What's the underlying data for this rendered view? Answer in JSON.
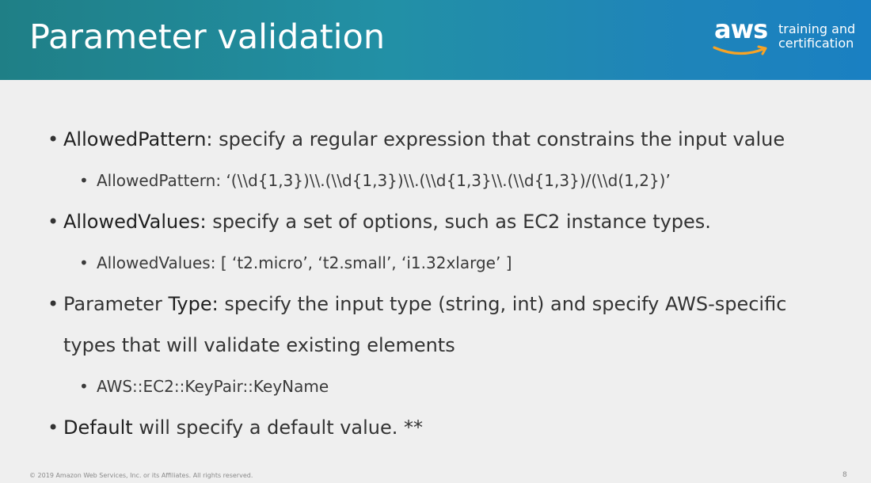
{
  "slide": {
    "title": "Parameter validation",
    "logo": {
      "word": "aws",
      "tag_line1": "training and",
      "tag_line2": "certification",
      "smile_color": "#f7a325"
    },
    "bullets": [
      {
        "level": 1,
        "term": "AllowedPattern:",
        "text": " specify a regular expression that constrains the input value"
      },
      {
        "level": 2,
        "text": "AllowedPattern: ‘(\\\\d{1,3})\\\\.(\\\\d{1,3})\\\\.(\\\\d{1,3}\\\\.(\\\\d{1,3})/(\\\\d(1,2})’"
      },
      {
        "level": 1,
        "term": "AllowedValues:",
        "text": " specify a set of options, such as EC2 instance types."
      },
      {
        "level": 2,
        "text": "AllowedValues: [ ‘t2.micro’, ‘t2.small’, ‘i1.32xlarge’ ]"
      },
      {
        "level": 1,
        "text": "Parameter ",
        "term": "Type:",
        "text2": " specify the input type (string, int) and specify AWS-specific"
      },
      {
        "level": 1,
        "continuation": true,
        "text": "types that will validate existing elements"
      },
      {
        "level": 2,
        "text": "AWS::EC2::KeyPair::KeyName"
      },
      {
        "level": 1,
        "term": "Default",
        "text": " will specify a default value. **"
      }
    ],
    "bullet_glyph": "•",
    "footer": "© 2019 Amazon Web Services, Inc. or its Affiliates. All rights reserved.",
    "page_number": "8"
  }
}
